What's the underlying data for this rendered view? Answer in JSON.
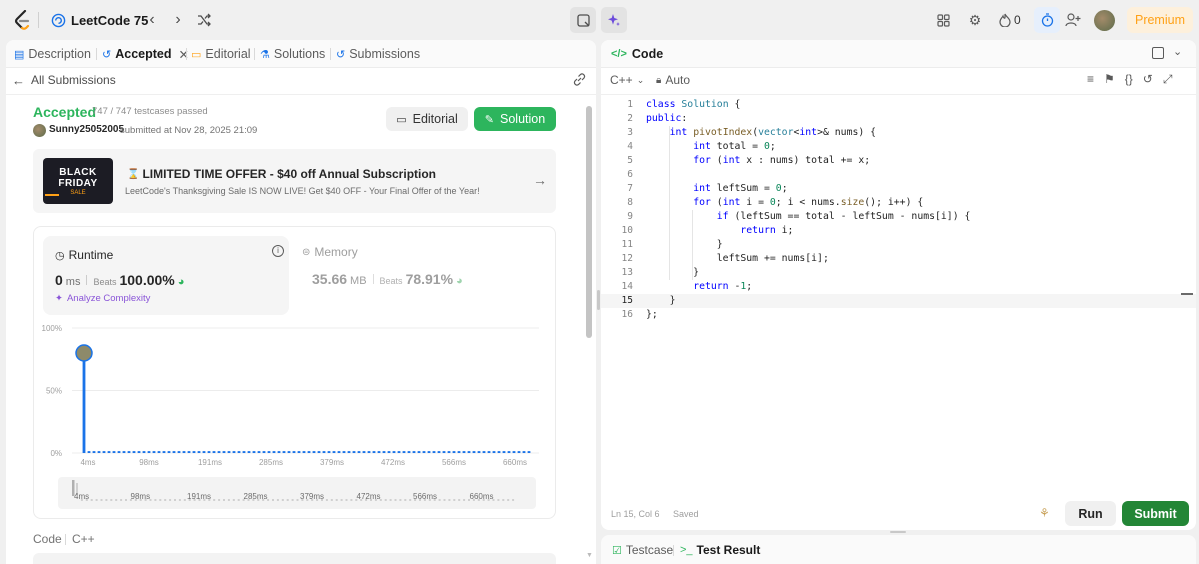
{
  "topbar": {
    "list_title": "LeetCode 75",
    "streak_count": "0",
    "premium_label": "Premium"
  },
  "left": {
    "tabs": [
      {
        "label": "Description",
        "icon": "description-icon"
      },
      {
        "label": "Accepted",
        "icon": "history-icon"
      },
      {
        "label": "Editorial",
        "icon": "book-icon"
      },
      {
        "label": "Solutions",
        "icon": "flask-icon"
      },
      {
        "label": "Submissions",
        "icon": "history-icon"
      }
    ],
    "back_label": "All Submissions",
    "status": "Accepted",
    "testcases": "747 / 747 testcases passed",
    "username": "Sunny25052005",
    "submitted_text": "submitted at Nov 28, 2025 21:09",
    "editorial_btn": "Editorial",
    "solution_btn": "Solution",
    "promo": {
      "badge_line1": "BLACK",
      "badge_line2": "FRIDAY",
      "badge_line3": "SALE",
      "title": "LIMITED TIME OFFER - $40 off Annual Subscription",
      "subtitle": "LeetCode's Thanksgiving Sale IS NOW LIVE! Get $40 OFF - Your Final Offer of the Year!"
    },
    "runtime": {
      "label": "Runtime",
      "value": "0",
      "unit": "ms",
      "beats_label": "Beats",
      "beats_value": "100.00%",
      "analyze": "Analyze Complexity"
    },
    "memory": {
      "label": "Memory",
      "value": "35.66",
      "unit": "MB",
      "beats_label": "Beats",
      "beats_value": "78.91%"
    },
    "code_label": "Code",
    "lang_label": "C++"
  },
  "chart_data": {
    "type": "bar",
    "yticks": [
      "100%",
      "50%",
      "0%"
    ],
    "ylim": [
      0,
      100
    ],
    "x_ticks": [
      "4ms",
      "98ms",
      "191ms",
      "285ms",
      "379ms",
      "472ms",
      "566ms",
      "660ms"
    ],
    "series": [
      {
        "values": [
          80,
          1.5,
          1.5,
          1.5,
          1.5,
          1.5,
          1.5,
          1.5,
          1.5,
          1.5,
          1.5,
          1.5,
          1.5,
          1.5,
          1.5,
          1.5,
          1.5,
          1.5,
          1.5,
          1.5,
          1.5,
          1.5,
          1.5,
          1.5,
          1.5,
          1.5,
          1.5,
          1.5,
          1.5,
          1.5,
          1.5,
          1.5,
          1.5,
          1.5,
          1.5,
          1.5,
          1.5,
          1.5,
          1.5,
          1.5,
          1.5,
          1.5,
          1.5,
          1.5,
          1.5,
          1.5,
          1.5,
          1.5,
          1.5,
          1.5,
          1.5,
          1.5,
          1.5,
          1.5,
          1.5,
          1.5,
          1.5,
          1.5,
          1.5,
          1.5,
          1.5,
          1.5,
          1.5,
          1.5,
          1.5,
          1.5,
          1.5,
          1.5,
          1.5,
          1.5,
          1.5,
          1.5,
          1.5,
          1.5,
          1.5,
          1.5,
          1.5,
          1.5,
          1.5,
          1.5,
          1.5,
          1.5,
          1.5,
          1.5,
          1.5,
          1.5,
          1.5,
          1.5,
          1.5,
          1.5
        ]
      }
    ],
    "bar_color": "#1a73e8",
    "slider_ticks": [
      "4ms",
      "98ms",
      "191ms",
      "285ms",
      "379ms",
      "472ms",
      "566ms",
      "660ms"
    ]
  },
  "right": {
    "title": "Code",
    "lang": "C++",
    "autocomplete": "Auto",
    "lines": [
      "class Solution {",
      "public:",
      "    int pivotIndex(vector<int>& nums) {",
      "        int total = 0;",
      "        for (int x : nums) total += x;",
      "",
      "        int leftSum = 0;",
      "        for (int i = 0; i < nums.size(); i++) {",
      "            if (leftSum == total - leftSum - nums[i]) {",
      "                return i;",
      "            }",
      "            leftSum += nums[i];",
      "        }",
      "        return -1;",
      "    }",
      "};"
    ],
    "line_numbers": [
      "1",
      "2",
      "3",
      "4",
      "5",
      "6",
      "7",
      "8",
      "9",
      "10",
      "11",
      "12",
      "13",
      "14",
      "15",
      "16"
    ],
    "cursor_pos": "Ln 15, Col 6",
    "saved": "Saved",
    "run_btn": "Run",
    "submit_btn": "Submit",
    "bottom_tabs": [
      "Testcase",
      "Test Result"
    ]
  },
  "colors": {
    "accepted": "#2db55d",
    "solution_btn": "#2db55d",
    "submit_btn": "#238636",
    "premium": "#ffa116",
    "accent_blue": "#1a73e8"
  }
}
